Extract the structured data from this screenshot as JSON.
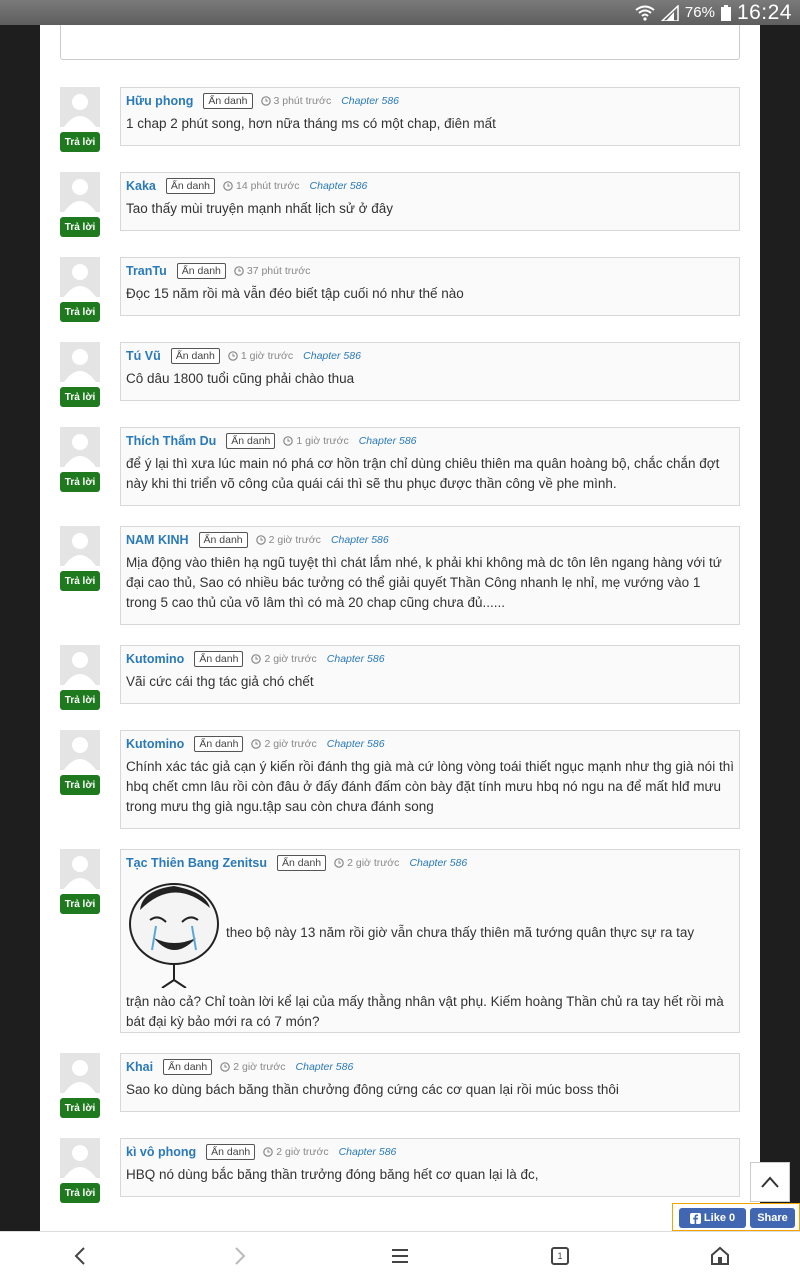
{
  "status": {
    "battery_pct": "76%",
    "time": "16:24"
  },
  "comments": [
    {
      "name": "Hữu phong",
      "anon": "Ẩn danh",
      "time": "3 phút trước",
      "chapter": "Chapter 586",
      "text": "1 chap 2 phút song, hơn nữa tháng ms có một chap, điên mất",
      "reply": "Trả lời"
    },
    {
      "name": "Kaka",
      "anon": "Ẩn danh",
      "time": "14 phút trước",
      "chapter": "Chapter 586",
      "text": "Tao thấy mùi truyện mạnh nhất lịch sử ở đây",
      "reply": "Trả lời"
    },
    {
      "name": "TranTu",
      "anon": "Ẩn danh",
      "time": "37 phút trước",
      "chapter": "",
      "text": "Đọc 15 năm rồi mà vẫn đéo biết tập cuối nó như thế nào",
      "reply": "Trả lời"
    },
    {
      "name": "Tú Vũ",
      "anon": "Ẩn danh",
      "time": "1 giờ trước",
      "chapter": "Chapter 586",
      "text": "Cô dâu 1800 tuổi cũng phải chào thua",
      "reply": "Trả lời"
    },
    {
      "name": "Thích Thẩm Du",
      "anon": "Ẩn danh",
      "time": "1 giờ trước",
      "chapter": "Chapter 586",
      "text": "để ý lại thì xưa lúc main nó phá cơ hồn trận chỉ dùng chiêu thiên ma quân hoàng bộ, chắc chắn đợt này khi thi triển võ công của quái cái thì sẽ thu phục được thần công về phe mình.",
      "reply": "Trả lời"
    },
    {
      "name": "NAM KINH",
      "anon": "Ẩn danh",
      "time": "2 giờ trước",
      "chapter": "Chapter 586",
      "text": "Mịa động vào thiên hạ ngũ tuyệt thì chát lắm nhé, k phải khi không mà dc tôn lên ngang hàng với tứ đại cao thủ, Sao có nhiều bác tưởng có thể giải quyết Thần Công nhanh lẹ nhỉ, mẹ vướng vào 1 trong 5 cao thủ của võ lâm thì có mà 20 chap cũng chưa đủ......",
      "reply": "Trả lời"
    },
    {
      "name": "Kutomino",
      "anon": "Ẩn danh",
      "time": "2 giờ trước",
      "chapter": "Chapter 586",
      "text": "Vãi cức cái thg tác giả chó chết",
      "reply": "Trả lời"
    },
    {
      "name": "Kutomino",
      "anon": "Ẩn danh",
      "time": "2 giờ trước",
      "chapter": "Chapter 586",
      "text": "Chính xác tác giả cạn ý kiến rồi đánh thg già mà cứ lòng vòng toái thiết ngục mạnh như thg già nói thì hbq chết cmn lâu rồi còn đâu ở đấy đánh đấm còn bày đặt tính mưu hbq nó ngu na để mất hlđ mưu trong mưu thg già ngu.tập sau còn chưa đánh song",
      "reply": "Trả lời"
    },
    {
      "name": "Tạc Thiên Bang Zenitsu",
      "anon": "Ẩn danh",
      "time": "2 giờ trước",
      "chapter": "Chapter 586",
      "text_inline": "theo bộ này 13 năm rồi giờ vẫn chưa thấy thiên mã tướng quân thực sự ra tay",
      "text": "trận nào cả? Chỉ toàn lời kể lại của mấy thằng nhân vật phụ. Kiếm hoàng Thần chủ ra tay hết rồi mà bát đại kỳ bảo mới ra có 7 món?",
      "reply": "Trả lời"
    },
    {
      "name": "Khai",
      "anon": "Ẩn danh",
      "time": "2 giờ trước",
      "chapter": "Chapter 586",
      "text": "Sao ko dùng bách băng thần chưởng đông cứng các cơ quan lại rồi múc boss thôi",
      "reply": "Trả lời"
    },
    {
      "name": "kì vô phong",
      "anon": "Ẩn danh",
      "time": "2 giờ trước",
      "chapter": "Chapter 586",
      "text": "HBQ nó dùng bắc băng thần trưởng đóng băng hết cơ quan lại là đc,",
      "reply": "Trả lời"
    }
  ],
  "fb": {
    "like_label": "Like",
    "like_count": "0",
    "share_label": "Share"
  },
  "nav": {
    "tab_count": "1"
  },
  "icons": [
    "wifi-icon",
    "signal-icon",
    "battery-icon",
    "clock-icon",
    "back-to-top-icon",
    "facebook-icon",
    "back-icon",
    "forward-icon",
    "menu-icon",
    "tabs-icon",
    "home-icon"
  ]
}
